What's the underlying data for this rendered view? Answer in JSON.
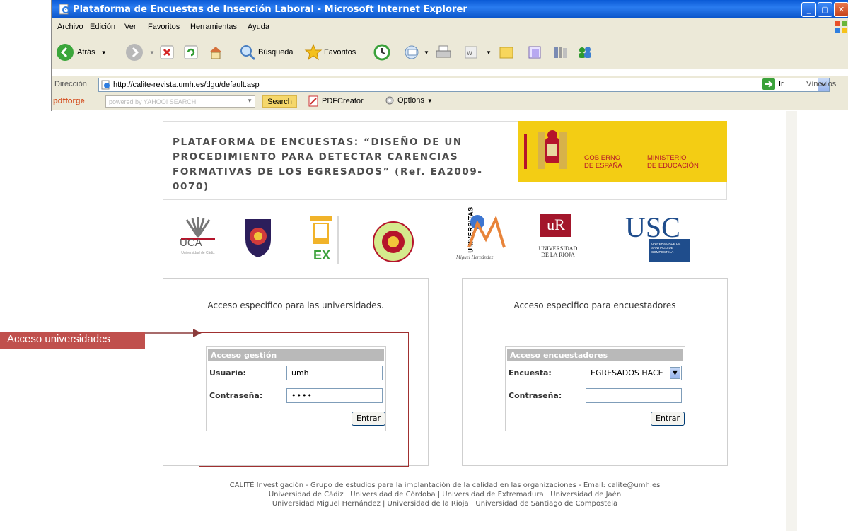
{
  "window": {
    "title": "Plataforma de Encuestas de Inserción Laboral - Microsoft Internet Explorer"
  },
  "menu": [
    "Archivo",
    "Edición",
    "Ver",
    "Favoritos",
    "Herramientas",
    "Ayuda"
  ],
  "toolbar": {
    "back_label": "Atrás",
    "search_label": "Búsqueda",
    "favorites_label": "Favoritos"
  },
  "address": {
    "label": "Dirección",
    "url": "http://calite-revista.umh.es/dgu/default.asp",
    "go_label": "Ir",
    "links_label": "Vínculos"
  },
  "pdfforge": {
    "logo_label": "pdfforge",
    "yahoo_text": "powered by YAHOO! SEARCH",
    "search_label": "Search",
    "pdfcreator_label": "PDFCreator",
    "options_label": "Options"
  },
  "header": {
    "title": "PLATAFORMA DE ENCUESTAS: “DISEÑO DE UN PROCEDIMIENTO PARA DETECTAR CARENCIAS FORMATIVAS DE LOS EGRESADOS” (Ref. EA2009-0070)",
    "gov_gobierno": "GOBIERNO\nDE ESPAÑA",
    "gov_ministerio": "MINISTERIO\nDE EDUCACIÓN"
  },
  "universities": {
    "uca": "UCA",
    "uca_sub": "Universidad de Cádiz",
    "extremadura": "EX",
    "umh_vertical": "UNIVERSITAS",
    "umh": "Miguel Hernández",
    "rioja": "UNIVERSIDAD DE LA RIOJA",
    "rioja_mark": "uR",
    "usc": "USC",
    "usc_sub": "UNIVERSIDADE DE SANTIAGO DE COMPOSTELA"
  },
  "panel_left": {
    "heading": "Acceso especifico para las universidades.",
    "box_title": "Acceso gestión",
    "user_label": "Usuario:",
    "user_value": "umh",
    "password_label": "Contraseña:",
    "password_value": "••••",
    "submit_label": "Entrar"
  },
  "panel_right": {
    "heading": "Acceso especifico para encuestadores",
    "box_title": "Acceso encuestadores",
    "survey_label": "Encuesta:",
    "survey_value": "EGRESADOS HACE",
    "password_label": "Contraseña:",
    "password_value": "",
    "submit_label": "Entrar"
  },
  "annotation": {
    "label": "Acceso universidades"
  },
  "footer": {
    "line1": "CALITÉ Investigación - Grupo de estudios para la implantación de la calidad en las organizaciones - Email: calite@umh.es",
    "line2": "Universidad de Cádiz | Universidad de Córdoba | Universidad de Extremadura | Universidad de Jaén",
    "line3": "Universidad Miguel Hernández | Universidad de la Rioja | Universidad de Santiago de Compostela"
  }
}
